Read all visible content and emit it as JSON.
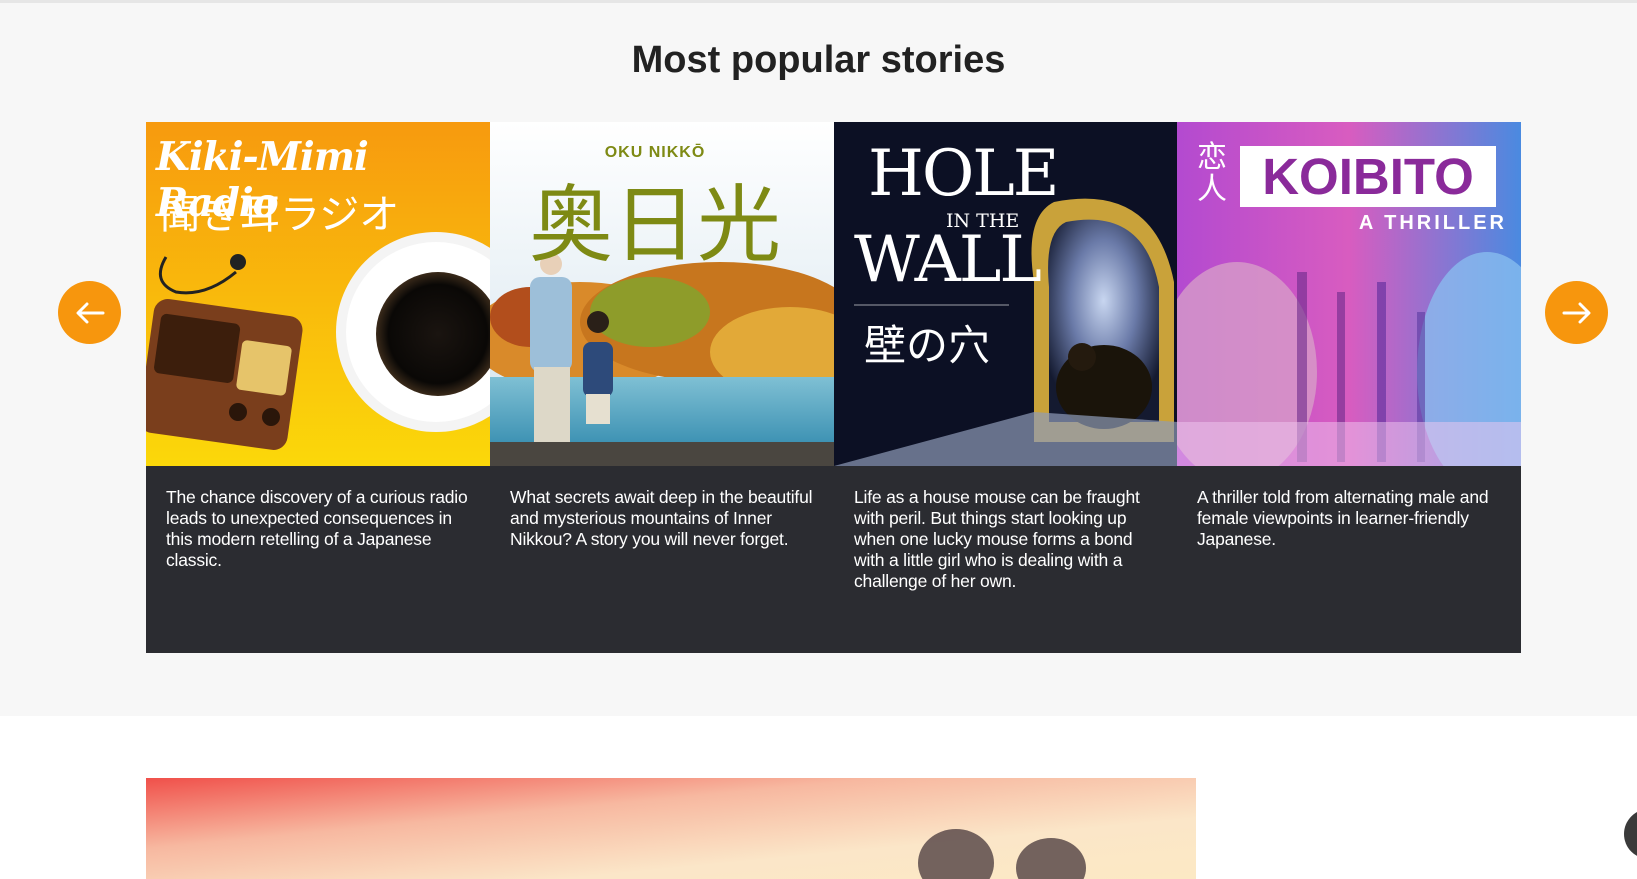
{
  "section": {
    "title": "Most popular stories"
  },
  "icons": {
    "prev": "arrow-left-icon",
    "next": "arrow-right-icon",
    "nav_color": "#f7960d"
  },
  "stories": [
    {
      "cover_title": "Kiki-Mimi Radio",
      "cover_subtitle": "聞き耳ラジオ",
      "description": "The chance discovery of a curious radio leads to unexpected consequences in this modern retelling of a Japanese classic."
    },
    {
      "cover_title": "OKU NIKKŌ",
      "cover_subtitle": "奥日光",
      "description": "What secrets await deep in the beautiful and mysterious mountains of Inner Nikkou? A story you will never forget."
    },
    {
      "cover_title_1": "HOLE",
      "cover_title_2": "IN THE",
      "cover_title_3": "WALL",
      "cover_subtitle": "壁の穴",
      "description": "Life as a house mouse can be fraught with peril. But things start looking up when one lucky mouse forms a bond with a little girl who is dealing with a challenge of her own."
    },
    {
      "cover_kanji": "恋人",
      "cover_title": "KOIBITO",
      "cover_subtitle": "A THRILLER",
      "description": "A thriller told from alternating male and female viewpoints in learner-friendly Japanese."
    }
  ]
}
